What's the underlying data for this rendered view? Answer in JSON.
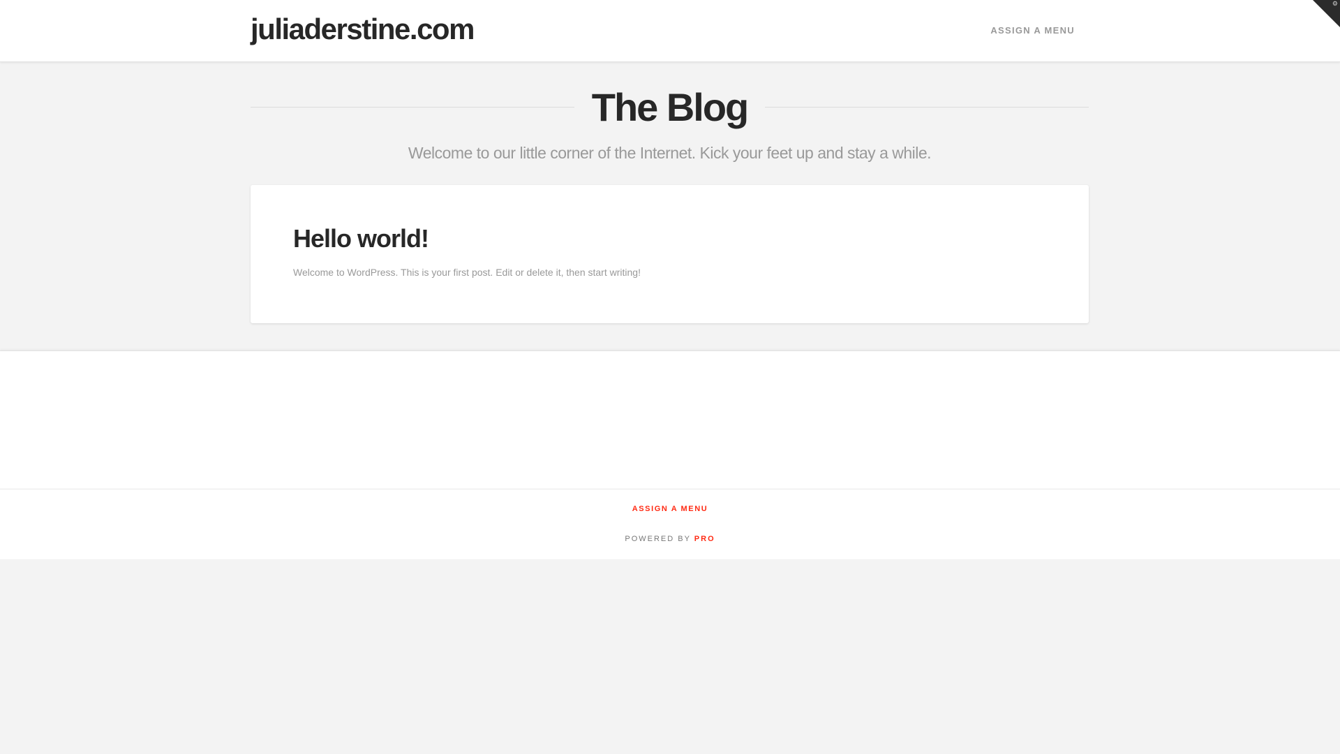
{
  "header": {
    "site_title": "juliaderstine.com",
    "nav_label": "ASSIGN A MENU"
  },
  "corner_toggle": {
    "icon": "gear-icon"
  },
  "blog": {
    "title": "The Blog",
    "subtitle": "Welcome to our little corner of the Internet. Kick your feet up and stay a while."
  },
  "post": {
    "title": "Hello world!",
    "excerpt": "Welcome to WordPress. This is your first post. Edit or delete it, then start writing!"
  },
  "footer": {
    "menu_label": "ASSIGN A MENU",
    "powered_prefix": "POWERED BY",
    "powered_link": "PRO"
  },
  "colors": {
    "accent": "#ff2a13",
    "background": "#f3f3f3",
    "heading": "#272727",
    "muted": "#999999"
  }
}
